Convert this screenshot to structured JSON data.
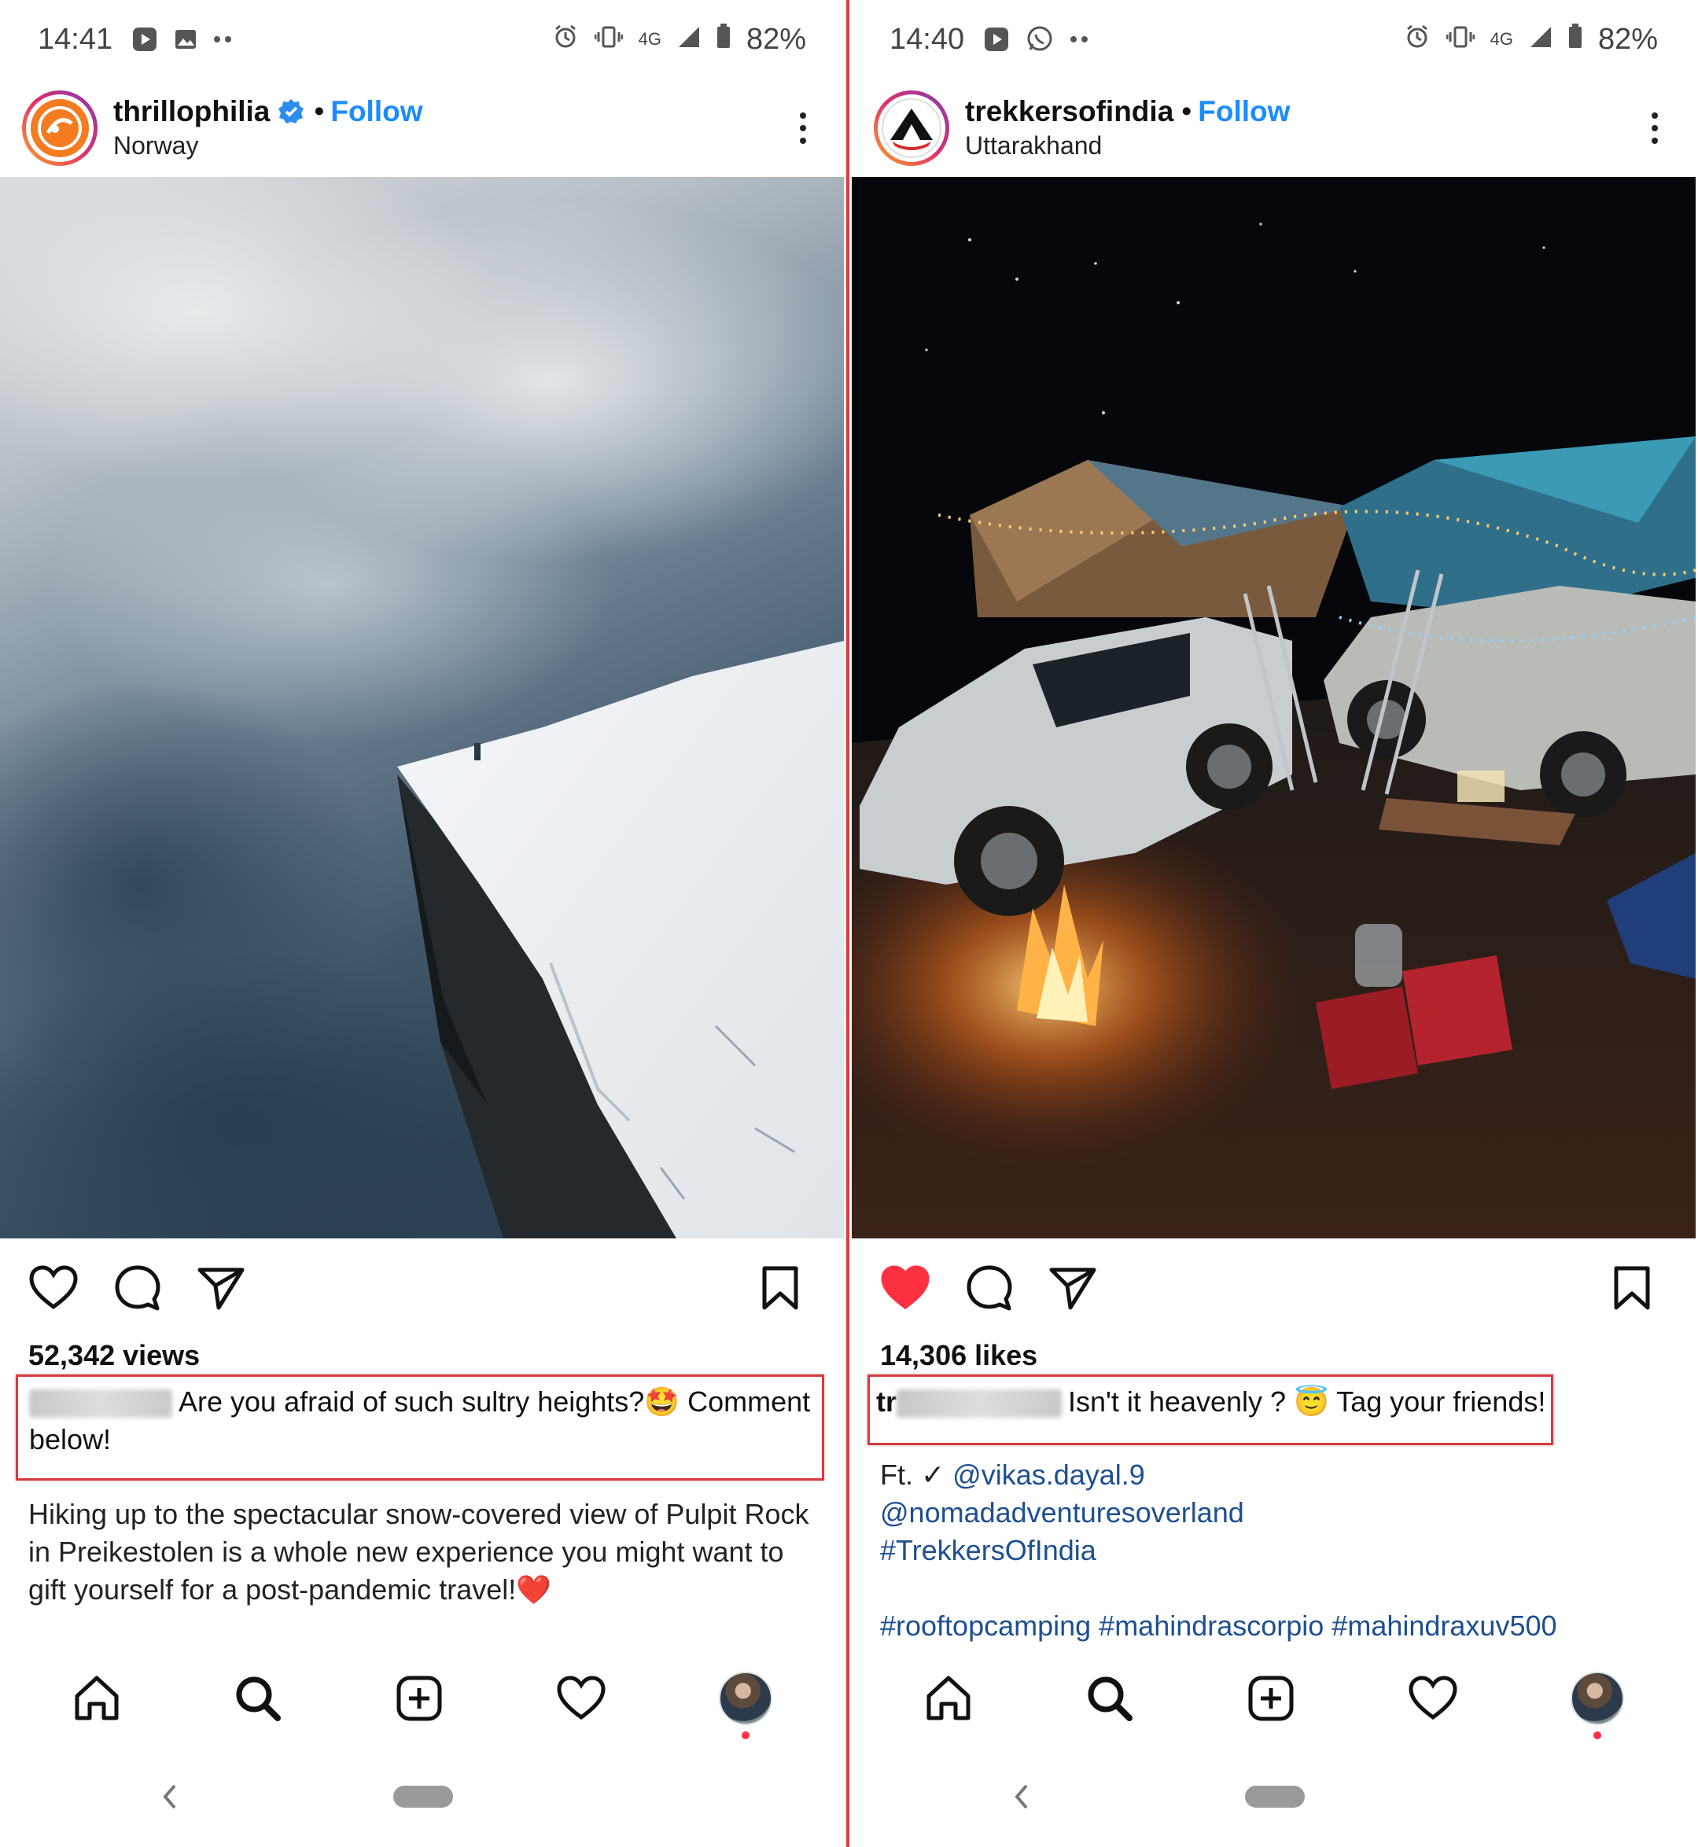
{
  "divider_color": "#e23b3b",
  "accent_color": "#1a8cff",
  "highlight_color": "#d9393f",
  "left": {
    "status": {
      "time": "14:41",
      "battery": "82%",
      "network": "4G"
    },
    "post": {
      "username": "thrillophilia",
      "verified": true,
      "follow_label": "Follow",
      "location": "Norway",
      "stat": "52,342 views",
      "liked": false,
      "caption_blurred_user": "thrillophilia",
      "caption": "Are you afraid of such sultry heights?🤩 Comment below!",
      "body": "Hiking up to the spectacular snow-covered view of Pulpit Rock in Preikestolen is a whole new experience you might want to gift yourself for a post-pandemic travel!",
      "body_emoji": "❤️"
    }
  },
  "right": {
    "status": {
      "time": "14:40",
      "battery": "82%",
      "network": "4G"
    },
    "post": {
      "username": "trekkersofindia",
      "verified": false,
      "follow_label": "Follow",
      "location": "Uttarakhand",
      "stat": "14,306 likes",
      "liked": true,
      "caption_user_prefix": "tr",
      "caption_blurred_user": "ekkersofindia",
      "caption": "Isn't it heavenly ? 😇 Tag your friends!",
      "ft_label": "Ft. ✓ ",
      "mentions": [
        "@vikas.dayal.9",
        "@nomadadventuresoverland"
      ],
      "hashtag_line1": "#TrekkersOfIndia",
      "hashtag_line2": "#rooftopcamping #mahindrascorpio #mahindraxuv500"
    }
  },
  "icons": {
    "like": "heart-icon",
    "comment": "comment-bubble-icon",
    "share": "paper-plane-icon",
    "save": "bookmark-icon",
    "home": "home-icon",
    "search": "search-icon",
    "create": "plus-square-icon",
    "activity": "heart-outline-icon",
    "profile": "profile-avatar"
  }
}
